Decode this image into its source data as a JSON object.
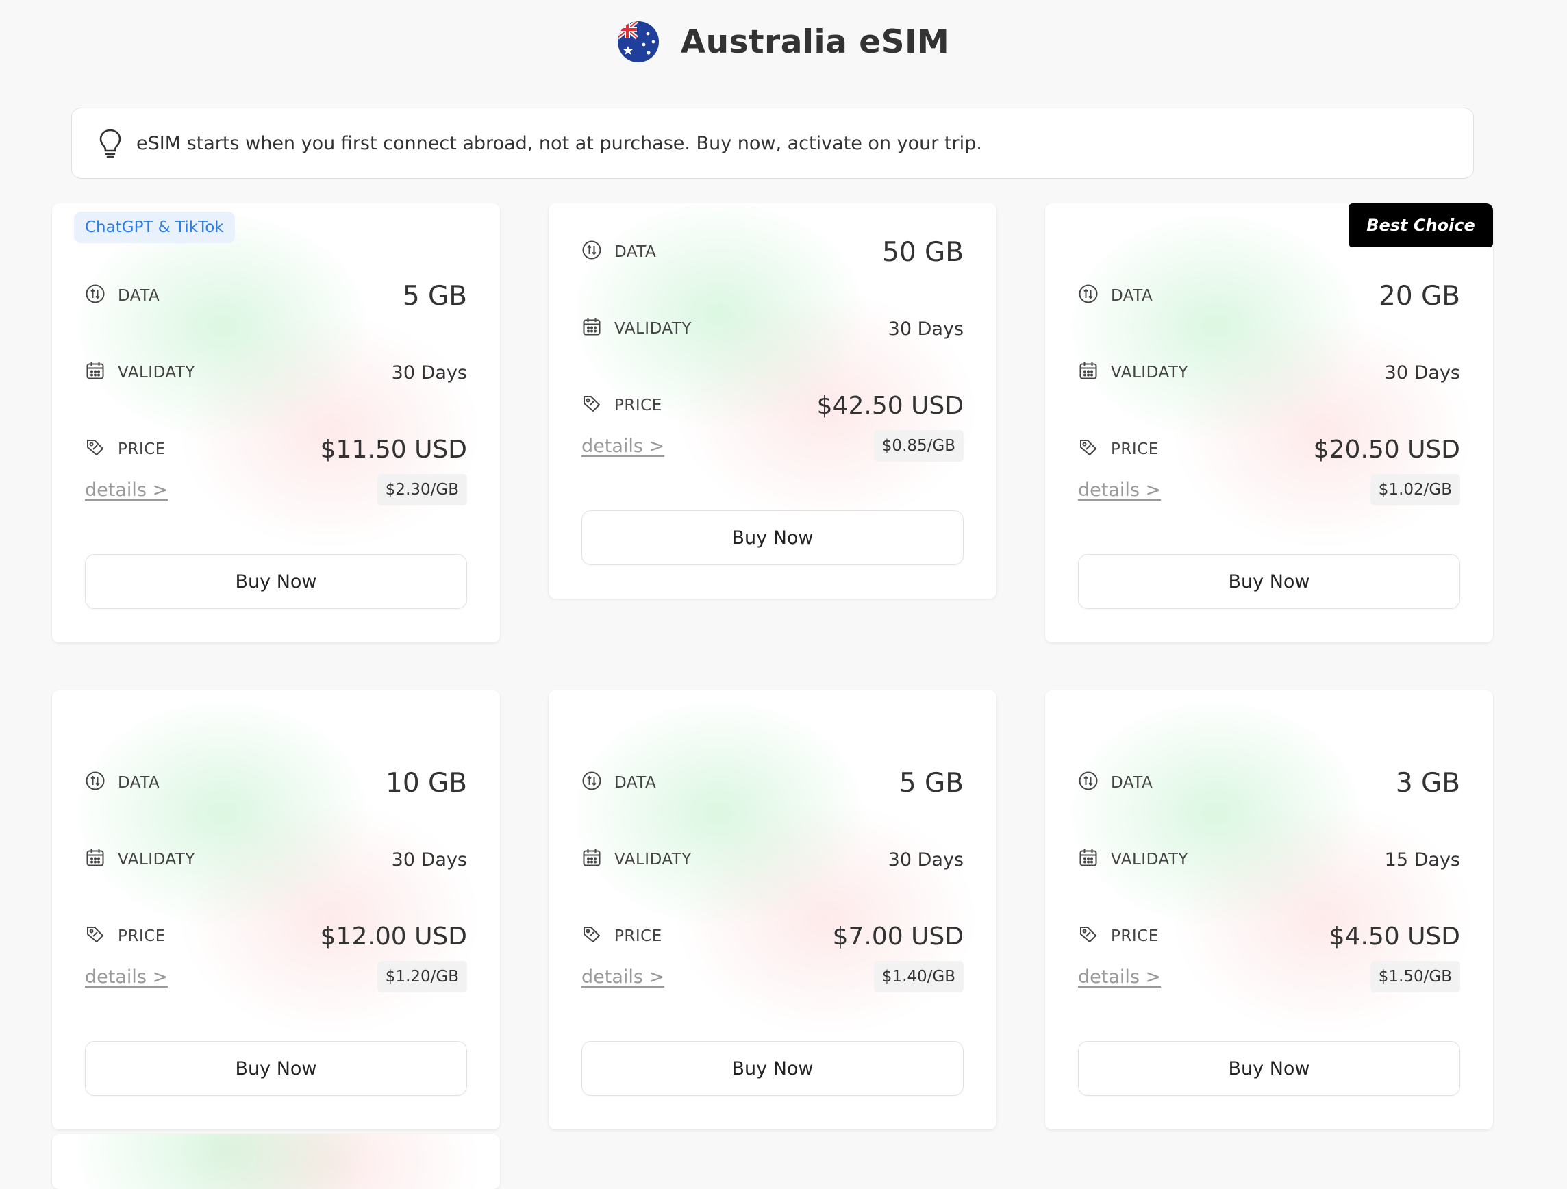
{
  "header": {
    "title": "Australia eSIM"
  },
  "notice": {
    "text": "eSIM starts when you first connect abroad, not at purchase. Buy now, activate on your trip."
  },
  "labels": {
    "data": "DATA",
    "validity": "VALIDATY",
    "price": "PRICE",
    "details": "details >",
    "buy": "Buy Now"
  },
  "plans": [
    {
      "tag": "ChatGPT & TikTok",
      "data": "5 GB",
      "validity": "30 Days",
      "price": "$11.50 USD",
      "per_gb": "$2.30/GB"
    },
    {
      "data": "50 GB",
      "validity": "30 Days",
      "price": "$42.50 USD",
      "per_gb": "$0.85/GB"
    },
    {
      "badge": "Best Choice",
      "data": "20 GB",
      "validity": "30 Days",
      "price": "$20.50 USD",
      "per_gb": "$1.02/GB"
    },
    {
      "data": "10 GB",
      "validity": "30 Days",
      "price": "$12.00 USD",
      "per_gb": "$1.20/GB"
    },
    {
      "data": "5 GB",
      "validity": "30 Days",
      "price": "$7.00 USD",
      "per_gb": "$1.40/GB"
    },
    {
      "data": "3 GB",
      "validity": "15 Days",
      "price": "$4.50 USD",
      "per_gb": "$1.50/GB"
    }
  ]
}
